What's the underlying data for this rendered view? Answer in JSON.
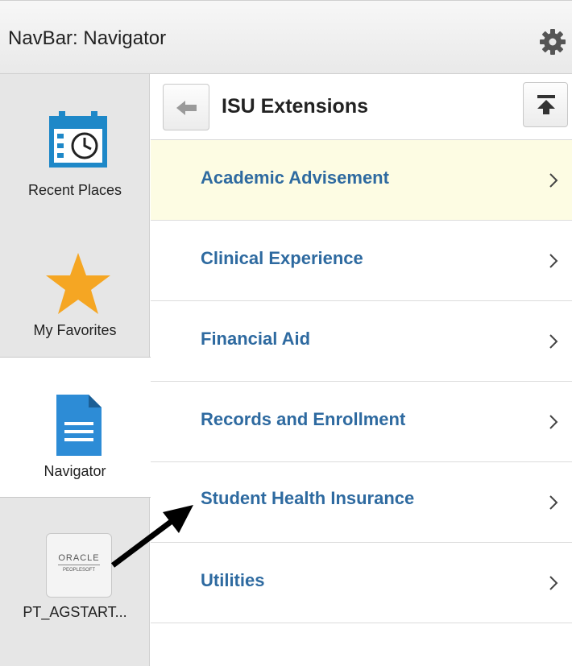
{
  "header": {
    "title": "NavBar: Navigator",
    "icon": "gear-icon"
  },
  "sidebar": {
    "items": [
      {
        "label": "Recent Places",
        "icon": "calendar-clock-icon"
      },
      {
        "label": "My Favorites",
        "icon": "star-icon"
      },
      {
        "label": "Navigator",
        "icon": "document-icon"
      },
      {
        "label": "PT_AGSTART...",
        "icon": "oracle-peoplesoft-icon",
        "logo_line1": "ORACLE",
        "logo_line2": "PEOPLESOFT"
      }
    ]
  },
  "breadcrumb": {
    "title": "ISU Extensions",
    "back_icon": "back-arrow-icon",
    "top_icon": "top-icon"
  },
  "menu": {
    "items": [
      {
        "label": "Academic Advisement"
      },
      {
        "label": "Clinical Experience"
      },
      {
        "label": "Financial Aid"
      },
      {
        "label": "Records and Enrollment"
      },
      {
        "label": "Student Health Insurance"
      },
      {
        "label": "Utilities"
      }
    ]
  },
  "colors": {
    "link": "#2e6aa0",
    "highlight": "#fdfce3",
    "star": "#f5a623",
    "calendar": "#1e88c8",
    "doc": "#2d8cd6"
  }
}
